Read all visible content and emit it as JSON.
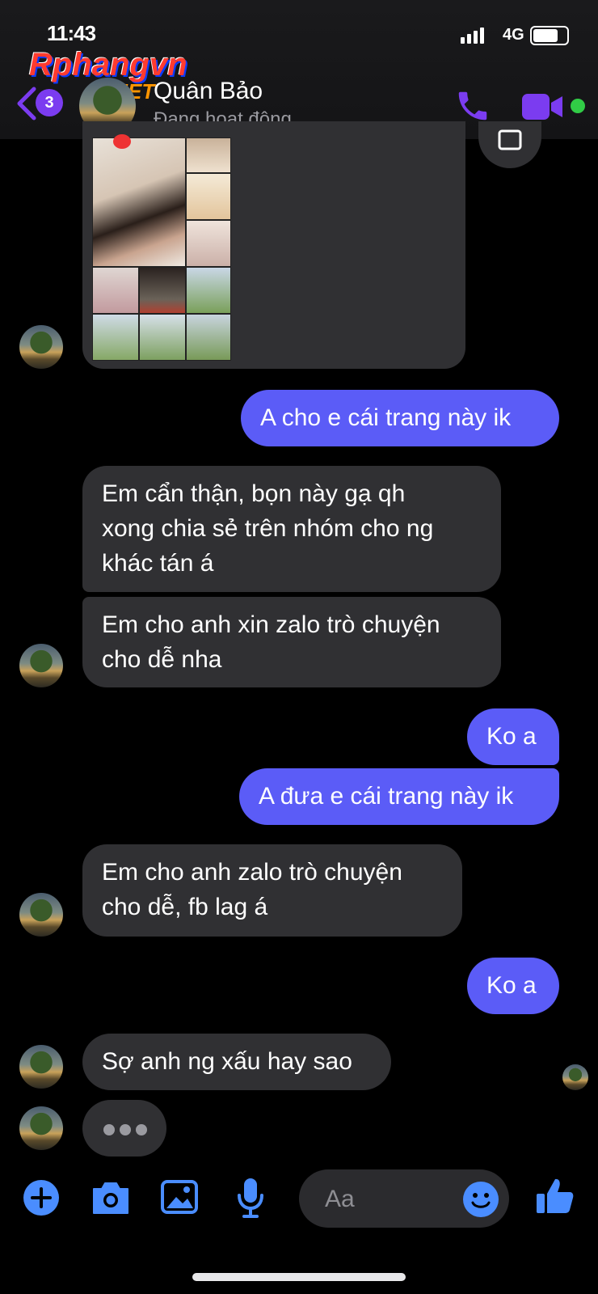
{
  "status_bar": {
    "time": "11:43",
    "network": "4G"
  },
  "watermark": {
    "brand": "Rphangvn",
    "suffix": ".NET"
  },
  "header": {
    "unread_count": "3",
    "contact_name": "Quân Bảo",
    "contact_status": "Đang hoạt động",
    "online": true
  },
  "messages": [
    {
      "from": "me",
      "text": "A cho e cái trang này ik"
    },
    {
      "from": "them",
      "text": "Em cẩn thận, bọn này gạ qh\nxong chia sẻ trên nhóm cho ng\nkhác tán á"
    },
    {
      "from": "them",
      "text": "Em cho anh xin zalo trò chuyện\ncho dễ nha"
    },
    {
      "from": "me",
      "text": "Ko a"
    },
    {
      "from": "me",
      "text": "A đưa e cái trang này ik"
    },
    {
      "from": "them",
      "text": "Em cho anh zalo trò chuyện\ncho dễ, fb lag á"
    },
    {
      "from": "me",
      "text": "Ko a"
    },
    {
      "from": "them",
      "text": "Sợ anh ng xấu hay sao"
    }
  ],
  "typing_indicator": true,
  "composer": {
    "placeholder": "Aa"
  },
  "colors": {
    "accent": "#7b3cf0",
    "outgoing_bubble": "#5b5cf7",
    "incoming_bubble": "#303033",
    "toolbar_icons": "#4a8dff",
    "online_dot": "#31cc46"
  },
  "icons": [
    "back-chevron-icon",
    "phone-icon",
    "video-camera-icon",
    "plus-icon",
    "camera-icon",
    "image-icon",
    "microphone-icon",
    "emoji-icon",
    "thumbs-up-icon"
  ]
}
